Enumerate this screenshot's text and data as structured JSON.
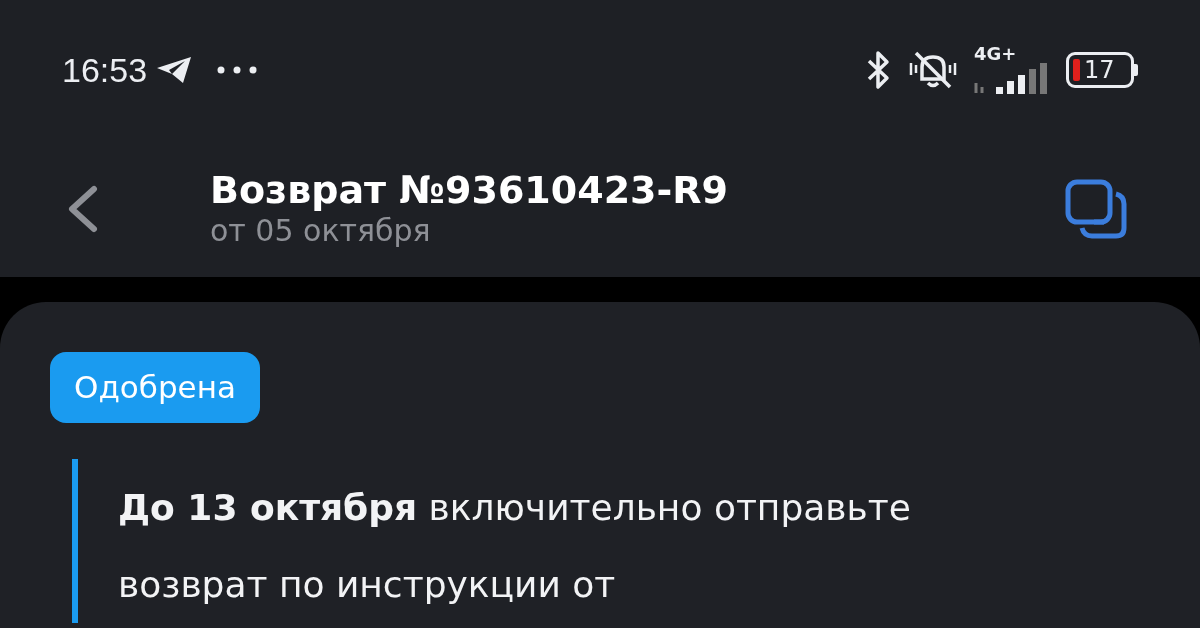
{
  "status_bar": {
    "time": "16:53",
    "network": "4G+",
    "battery": "17"
  },
  "header": {
    "title": "Возврат №93610423-R9",
    "subtitle": "от 05 октября"
  },
  "status_badge": {
    "label": "Одобрена",
    "color": "#1a9bf0"
  },
  "notice": {
    "text": "**До 13 октября** включительно отправьте возврат по инструкции от"
  }
}
